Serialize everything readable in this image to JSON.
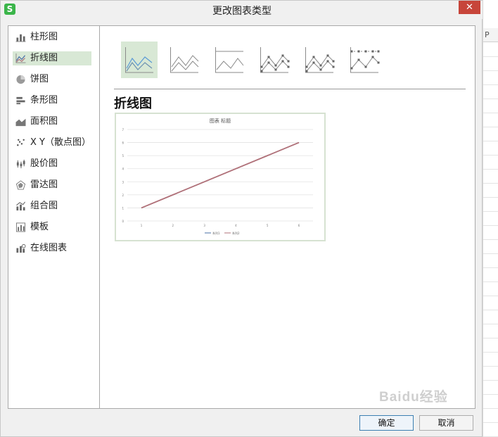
{
  "window": {
    "title": "更改图表类型",
    "app_icon": "S",
    "close_label": "✕"
  },
  "sidebar": {
    "items": [
      {
        "label": "柱形图",
        "icon": "column-chart-icon"
      },
      {
        "label": "折线图",
        "icon": "line-chart-icon",
        "selected": true
      },
      {
        "label": "饼图",
        "icon": "pie-chart-icon"
      },
      {
        "label": "条形图",
        "icon": "bar-chart-icon"
      },
      {
        "label": "面积图",
        "icon": "area-chart-icon"
      },
      {
        "label": "X Y（散点图）",
        "icon": "scatter-chart-icon"
      },
      {
        "label": "股价图",
        "icon": "stock-chart-icon"
      },
      {
        "label": "雷达图",
        "icon": "radar-chart-icon"
      },
      {
        "label": "组合图",
        "icon": "combo-chart-icon"
      },
      {
        "label": "模板",
        "icon": "template-icon"
      },
      {
        "label": "在线图表",
        "icon": "online-chart-icon"
      }
    ]
  },
  "subtypes": [
    {
      "name": "line",
      "selected": true
    },
    {
      "name": "stacked-line"
    },
    {
      "name": "percent-stacked-line"
    },
    {
      "name": "line-with-markers"
    },
    {
      "name": "stacked-line-with-markers"
    },
    {
      "name": "percent-stacked-line-with-markers"
    }
  ],
  "main": {
    "heading": "折线图"
  },
  "preview": {
    "title": "图表 标题",
    "y_ticks": [
      "0",
      "1",
      "2",
      "3",
      "4",
      "5",
      "6",
      "7"
    ],
    "x_ticks": [
      "1",
      "2",
      "3",
      "4",
      "5",
      "6"
    ],
    "legend": [
      "系列1",
      "系列2"
    ]
  },
  "chart_data": {
    "type": "line",
    "title": "图表 标题",
    "categories": [
      "1",
      "2",
      "3",
      "4",
      "5",
      "6"
    ],
    "series": [
      {
        "name": "系列1",
        "values": [
          1,
          2,
          3,
          4,
          5,
          6
        ],
        "color": "#4a6fa5"
      },
      {
        "name": "系列2",
        "values": [
          1,
          2,
          3,
          4,
          5,
          6
        ],
        "color": "#b07078"
      }
    ],
    "ylim": [
      0,
      7
    ],
    "grid": true,
    "legend": "bottom"
  },
  "buttons": {
    "ok": "确定",
    "cancel": "取消"
  },
  "side_strip": {
    "column_header": "P"
  },
  "watermark": "Baidu经验",
  "colors": {
    "selected_bg": "#d8e8d5",
    "close_bg": "#c7453a",
    "icon_green": "#3bb54a"
  }
}
